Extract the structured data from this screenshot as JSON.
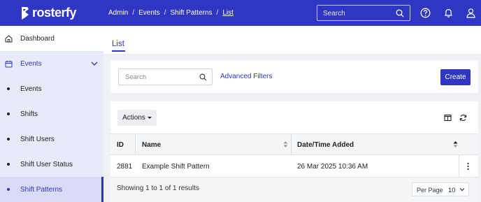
{
  "header": {
    "logo_text": "rosterfy",
    "breadcrumb": [
      "Admin",
      "Events",
      "Shift Patterns",
      "List"
    ],
    "search_placeholder": "Search",
    "icons": [
      "help-icon",
      "bell-icon",
      "user-icon"
    ]
  },
  "sidebar": {
    "items": [
      {
        "label": "Dashboard",
        "icon": "home-icon"
      },
      {
        "label": "Events",
        "icon": "calendar-icon",
        "expanded": true
      },
      {
        "label": "Events"
      },
      {
        "label": "Shifts"
      },
      {
        "label": "Shift Users"
      },
      {
        "label": "Shift User Status"
      },
      {
        "label": "Shift Patterns",
        "active": true
      }
    ]
  },
  "tabs": [
    {
      "label": "List",
      "active": true
    }
  ],
  "filters": {
    "search_placeholder": "Search",
    "advanced_label": "Advanced Filters",
    "create_label": "Create"
  },
  "table": {
    "actions_label": "Actions",
    "columns": [
      "ID",
      "Name",
      "Date/Time Added"
    ],
    "rows": [
      {
        "id": "2881",
        "name": "Example Shift Pattern",
        "added": "26 Mar 2025 10:36 AM"
      }
    ],
    "showing": "Showing 1 to 1 of 1 results",
    "per_page_label": "Per Page",
    "per_page_value": "10"
  },
  "colors": {
    "brand": "#2f36c2",
    "sidebar_active": "#d9dbf6",
    "sidebar_group": "#e8e9f9"
  }
}
